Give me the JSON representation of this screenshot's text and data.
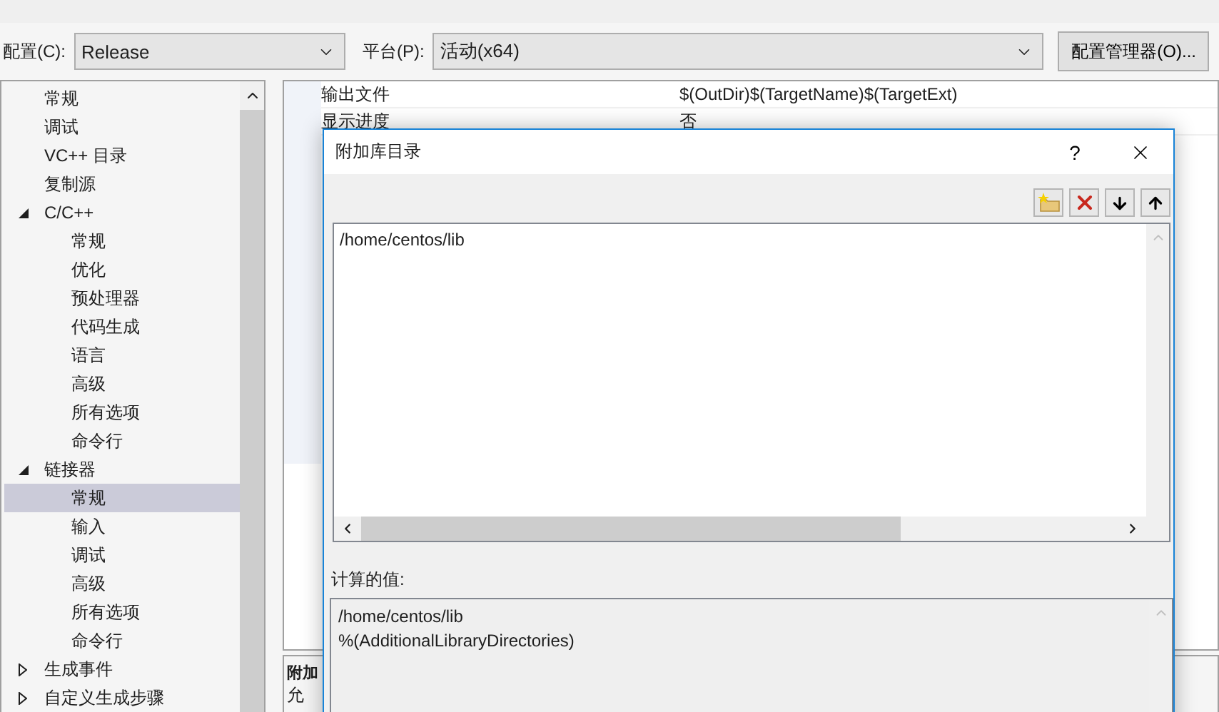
{
  "config_bar": {
    "config_label": "配置(C):",
    "config_value": "Release",
    "platform_label": "平台(P):",
    "platform_value": "活动(x64)",
    "manager_button": "配置管理器(O)..."
  },
  "tree": [
    {
      "label": "常规",
      "selected": false
    },
    {
      "label": "调试",
      "selected": false
    },
    {
      "label": "VC++ 目录",
      "selected": false
    },
    {
      "label": "复制源",
      "selected": false
    },
    {
      "label": "C/C++",
      "selected": false,
      "expanded": true,
      "children": [
        {
          "label": "常规",
          "selected": false
        },
        {
          "label": "优化",
          "selected": false
        },
        {
          "label": "预处理器",
          "selected": false
        },
        {
          "label": "代码生成",
          "selected": false
        },
        {
          "label": "语言",
          "selected": false
        },
        {
          "label": "高级",
          "selected": false
        },
        {
          "label": "所有选项",
          "selected": false
        },
        {
          "label": "命令行",
          "selected": false
        }
      ]
    },
    {
      "label": "链接器",
      "selected": false,
      "expanded": true,
      "children": [
        {
          "label": "常规",
          "selected": true
        },
        {
          "label": "输入",
          "selected": false
        },
        {
          "label": "调试",
          "selected": false
        },
        {
          "label": "高级",
          "selected": false
        },
        {
          "label": "所有选项",
          "selected": false
        },
        {
          "label": "命令行",
          "selected": false
        }
      ]
    },
    {
      "label": "生成事件",
      "selected": false,
      "expanded": false
    },
    {
      "label": "自定义生成步骤",
      "selected": false,
      "expanded": false
    }
  ],
  "properties": [
    {
      "name": "输出文件",
      "value": "$(OutDir)$(TargetName)$(TargetExt)"
    },
    {
      "name": "显示进度",
      "value": "否"
    }
  ],
  "description": {
    "title": "附加",
    "text": "允"
  },
  "dialog": {
    "title": "附加库目录",
    "help": "?",
    "entries": [
      "/home/centos/lib"
    ],
    "computed_label": "计算的值:",
    "computed_lines": [
      "/home/centos/lib",
      "%(AdditionalLibraryDirectories)"
    ]
  }
}
